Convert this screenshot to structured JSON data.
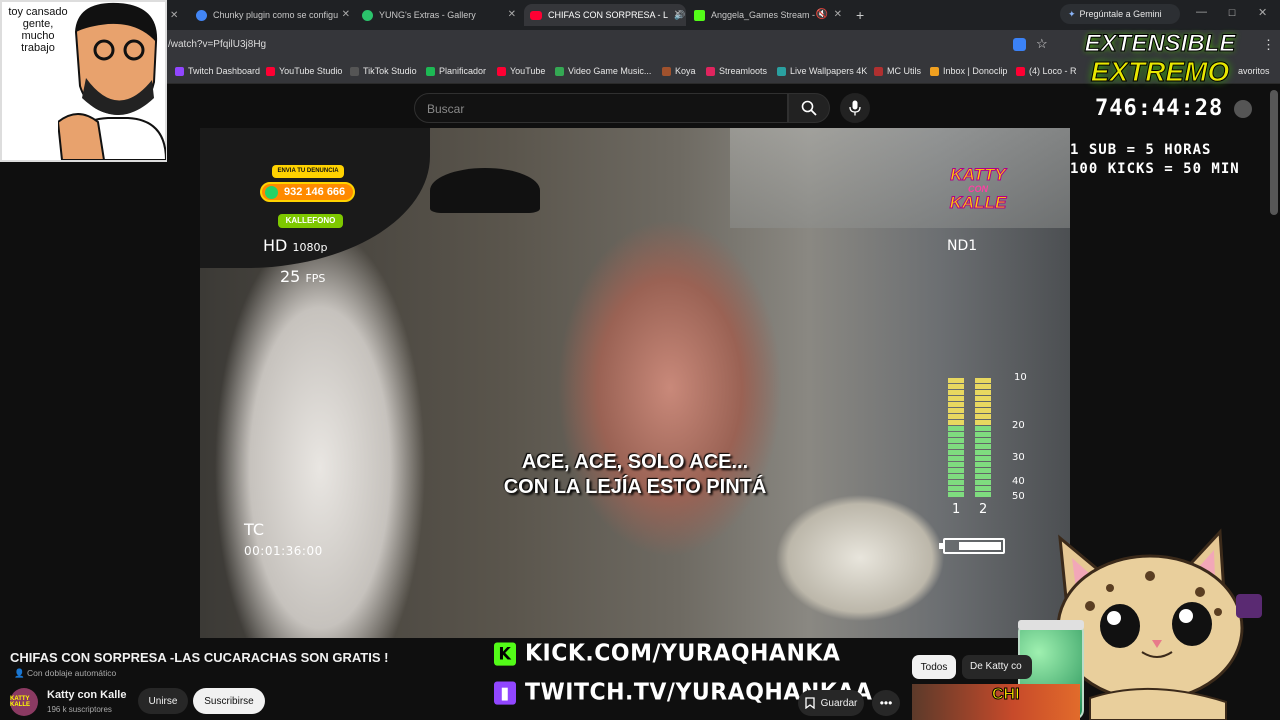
{
  "browser": {
    "tabs": [
      {
        "title": "Chunky plugin como se configu",
        "color": "#4285f4"
      },
      {
        "title": "YUNG's Extras - Gallery",
        "color": "#2bc36b"
      },
      {
        "title": "CHIFAS CON SORPRESA - L",
        "color": "#ff0033"
      },
      {
        "title": "Anggela_Games Stream - V",
        "color": "#53fc18"
      }
    ],
    "new_tab": "+",
    "gemini_label": "Pregúntale a Gemini",
    "url": "/watch?v=PfqilU3j8Hg",
    "bookmarks": [
      {
        "label": "Twitch Dashboard",
        "color": "#9146ff"
      },
      {
        "label": "YouTube Studio",
        "color": "#ff0033"
      },
      {
        "label": "TikTok Studio",
        "color": "#222222"
      },
      {
        "label": "Planificador",
        "color": "#1db954"
      },
      {
        "label": "YouTube",
        "color": "#ff0033"
      },
      {
        "label": "Video Game Music...",
        "color": "#34a853"
      },
      {
        "label": "Koya",
        "color": "#a0522d"
      },
      {
        "label": "Streamloots",
        "color": "#e0245e"
      },
      {
        "label": "Live Wallpapers 4K",
        "color": "#2aa0a0"
      },
      {
        "label": "MC Utils",
        "color": "#b03030"
      },
      {
        "label": "Inbox | Donoclip",
        "color": "#f0a020"
      },
      {
        "label": "(4) Loco - R",
        "color": "#ff0033"
      },
      {
        "label": "avoritos",
        "color": "#35363a"
      }
    ]
  },
  "youtube": {
    "search_placeholder": "Buscar",
    "video_title": "CHIFAS CON SORPRESA -LAS CUCARACHAS SON GRATIS !",
    "dubbing": "Con doblaje automático",
    "channel_name": "Katty con Kalle",
    "channel_avatar_text": "KATTY KALLE",
    "subscribers": "196 k suscriptores",
    "join_label": "Unirse",
    "subscribe_label": "Suscribirse",
    "save_label": "Guardar",
    "more_label": "•••",
    "chip_all": "Todos",
    "chip_channel": "De Katty co",
    "rec_thumb_text": "CHI"
  },
  "video_overlay": {
    "denuncia_label": "ENVIA TU DENUNCIA",
    "phone": "932 146 666",
    "kallefono": "KALLEFONO",
    "hd": "HD",
    "resolution": "1080p",
    "fps_value": "25",
    "fps_label": "FPS",
    "logo_line1": "KATTY",
    "logo_line2": "CON",
    "logo_line3": "KALLE",
    "nd": "ND1",
    "subtitle_line1": "ACE, ACE, SOLO ACE...",
    "subtitle_line2": "CON LA LEJÍA ESTO PINTÁ",
    "tc_label": "TC",
    "timecode": "00:01:36:00",
    "meter_scale": [
      "10",
      "20",
      "30",
      "40",
      "50"
    ],
    "meter_channels": [
      "1",
      "2"
    ]
  },
  "stream_overlay": {
    "webcam_note": "toy cansado gente, mucho trabajo",
    "extensible_line1": "EXTENSIBLE",
    "extensible_line2": "EXTREMO",
    "timer": "746:44:28",
    "rule_sub": "1 SUB = 5 HORAS",
    "rule_kicks": "100 KICKS = 50 MIN",
    "kick_url": "KICK.COM/YURAQHANKA",
    "twitch_url": "TWITCH.TV/YURAQHANKAA",
    "kick_color": "#53fc18",
    "twitch_color": "#9146ff"
  }
}
